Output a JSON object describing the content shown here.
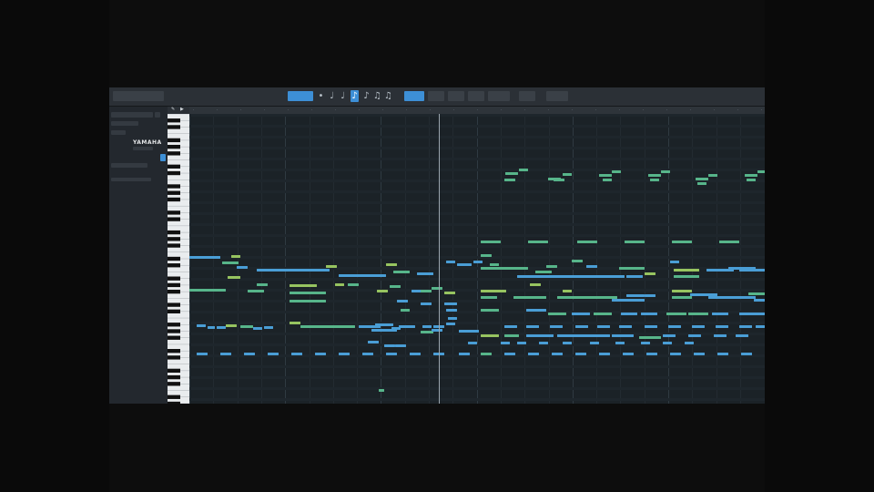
{
  "colors": {
    "accent": "#3d8fd6",
    "note_blue": "#4a9ed6",
    "note_green": "#57b58a",
    "note_yellowgreen": "#97c460",
    "background": "#1b2227"
  },
  "inspector": {
    "brand": "YAMAHA"
  },
  "keyboard": {
    "head_icons": [
      "pencil-icon",
      "arrow-icon"
    ]
  },
  "toolbar": {
    "note_values": [
      "whole-note-icon",
      "half-note-icon",
      "quarter-note-icon",
      "eighth-note-icon",
      "sixteenth-note-icon",
      "thirty-second-note-icon"
    ],
    "active_note_value": 3
  }
}
